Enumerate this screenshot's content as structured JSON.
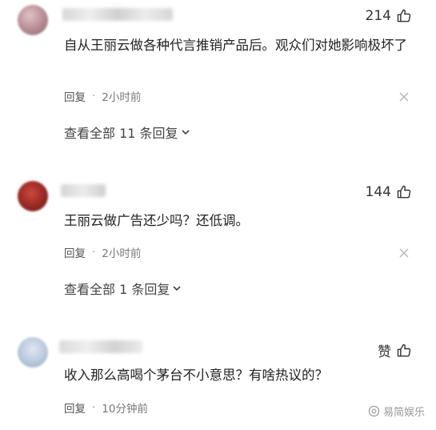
{
  "comments": [
    {
      "likes": "214",
      "text": "自从王丽云做各种代言推销产品后。观众们对她影响极坏了",
      "reply_label": "回复",
      "dot": "·",
      "time": "2小时前",
      "more_replies": "查看全部 11 条回复"
    },
    {
      "likes": "144",
      "text": "王丽云做广告还少吗？还低调。",
      "reply_label": "回复",
      "dot": "·",
      "time": "2小时前",
      "more_replies": "查看全部 1 条回复"
    },
    {
      "likes": "赞",
      "text": "收入那么高喝个茅台不小意思？有啥热议的？",
      "reply_label": "回复",
      "dot": "·",
      "time": "10分钟前"
    }
  ],
  "watermark": {
    "text": "易简娱乐"
  },
  "icons": {
    "like": "thumb-up-icon",
    "close": "close-icon",
    "expand": "chevron-down-icon"
  },
  "colors": {
    "text": "#222222",
    "meta": "#777777",
    "icon": "#b5b5b5"
  }
}
